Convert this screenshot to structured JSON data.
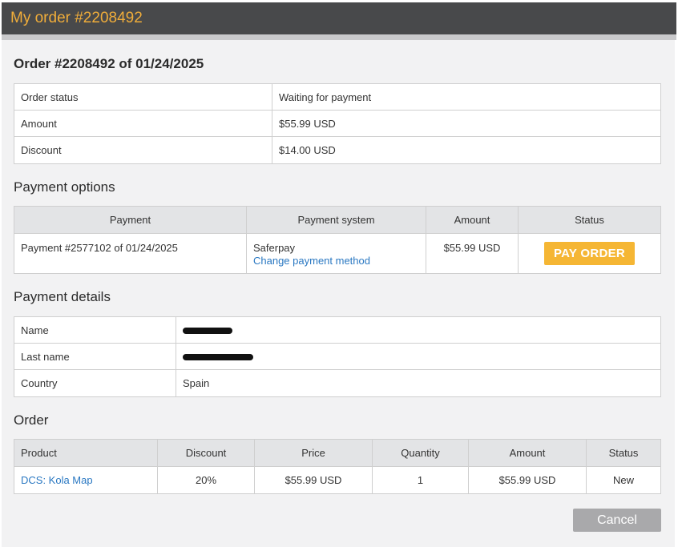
{
  "window": {
    "title": "My order #2208492"
  },
  "order_header": "Order #2208492 of 01/24/2025",
  "summary": [
    {
      "label": "Order status",
      "value": "Waiting for payment"
    },
    {
      "label": "Amount",
      "value": "$55.99 USD"
    },
    {
      "label": "Discount",
      "value": "$14.00 USD"
    }
  ],
  "payment_options": {
    "heading": "Payment options",
    "columns": [
      "Payment",
      "Payment system",
      "Amount",
      "Status"
    ],
    "row": {
      "payment": "Payment #2577102 of 01/24/2025",
      "system": "Saferpay",
      "change_link": "Change payment method",
      "amount": "$55.99 USD",
      "pay_button": "PAY ORDER"
    }
  },
  "payment_details": {
    "heading": "Payment details",
    "rows": [
      {
        "label": "Name",
        "value": ""
      },
      {
        "label": "Last name",
        "value": ""
      },
      {
        "label": "Country",
        "value": "Spain"
      }
    ]
  },
  "order": {
    "heading": "Order",
    "columns": [
      "Product",
      "Discount",
      "Price",
      "Quantity",
      "Amount",
      "Status"
    ],
    "rows": [
      {
        "product": "DCS: Kola Map",
        "discount": "20%",
        "price": "$55.99 USD",
        "quantity": "1",
        "amount": "$55.99 USD",
        "status": "New"
      }
    ]
  },
  "cancel_label": "Cancel",
  "colors": {
    "title_text": "#f0ad3a",
    "pay_button": "#f5b634",
    "link": "#2a78c2",
    "cancel_button": "#a9a9ab"
  }
}
